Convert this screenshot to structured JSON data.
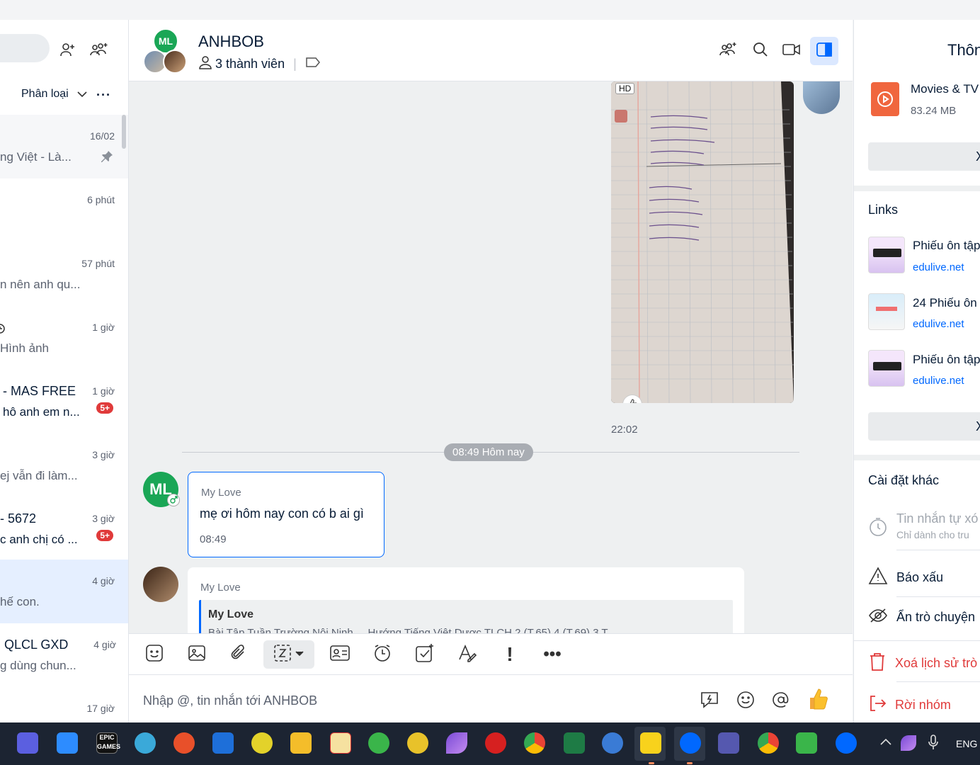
{
  "left": {
    "filter_label": "Phân loại",
    "conversations": [
      {
        "name": "",
        "preview": "ng Việt - Là...",
        "time": "16/02",
        "pinned": true,
        "badge": ""
      },
      {
        "name": "",
        "preview": "",
        "time": "6 phút",
        "badge": ""
      },
      {
        "name": "",
        "preview": "n nên anh qu...",
        "time": "57 phút",
        "badge": ""
      },
      {
        "name": "",
        "preview": "Hình ảnh",
        "time": "1 giờ",
        "badge": ""
      },
      {
        "name": "- MAS FREE",
        "preview": "hô anh em n...",
        "time": "1 giờ",
        "badge": "5+"
      },
      {
        "name": "",
        "preview": "ej vẫn đi làm...",
        "time": "3 giờ",
        "badge": ""
      },
      {
        "name": "- 5672",
        "preview": "c anh chị có ...",
        "time": "3 giờ",
        "badge": "5+"
      },
      {
        "name": "",
        "preview": "hế con.",
        "time": "4 giờ",
        "badge": ""
      },
      {
        "name": "QLCL GXD",
        "preview": "g dùng chun...",
        "time": "4 giờ",
        "badge": ""
      },
      {
        "name": "",
        "preview": "",
        "time": "17 giờ",
        "badge": ""
      }
    ]
  },
  "header": {
    "avatar_initials": "ML",
    "title": "ANHBOB",
    "members": "3 thành viên"
  },
  "messages": {
    "image_badge": "HD",
    "image_time": "22:02",
    "date_divider": "08:49 Hôm nay",
    "msg1": {
      "avatar": "ML",
      "sender": "My Love",
      "text": "mẹ ơi hôm nay con có  b ai gì",
      "time": "08:49"
    },
    "msg2": {
      "sender": "My Love",
      "quote_sender": "My Love",
      "quote_text": "Bài Tập Tuần Trường Nội Ninh ... Hướng Tiếng Việt Dược TLCH 2 (T.65) 4 (T.69) 3 T"
    }
  },
  "input": {
    "placeholder": "Nhập @, tin nhắn tới ANHBOB"
  },
  "right": {
    "title": "Thôn",
    "file": {
      "name": "Movies & TV",
      "size": "83.24 MB"
    },
    "links_title": "Links",
    "links": [
      {
        "title": "Phiếu ôn tập",
        "domain": "edulive.net"
      },
      {
        "title": "24 Phiếu ôn",
        "domain": "edulive.net"
      },
      {
        "title": "Phiếu ôn tập",
        "domain": "edulive.net"
      }
    ],
    "other_settings_title": "Cài đặt khác",
    "auto_msg": "Tin nhắn tự xó",
    "auto_msg_sub": "Chỉ dành cho tru",
    "report": "Báo xấu",
    "hide": "Ẩn trò chuyện",
    "delete_history": "Xoá lịch sử trò",
    "leave": "Rời nhóm"
  },
  "taskbar": {
    "lang": "ENG"
  },
  "colors": {
    "accent": "#0068ff",
    "danger": "#e03a3a",
    "avatar_green": "#1aa656"
  }
}
